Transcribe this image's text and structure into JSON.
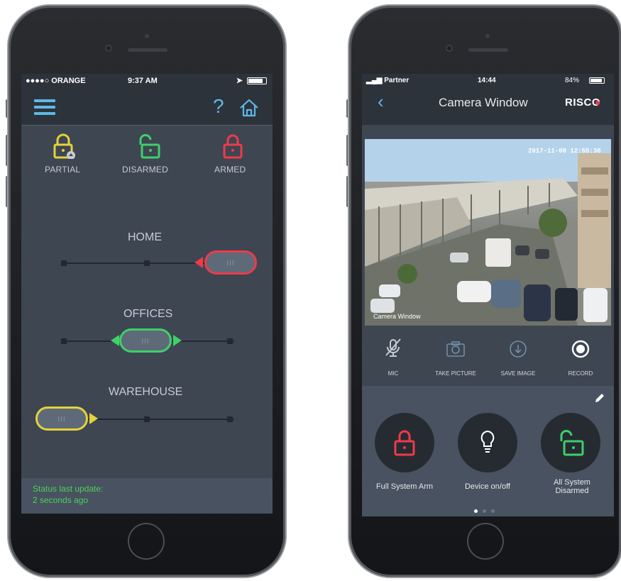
{
  "colors": {
    "partial": "#e4d23a",
    "disarmed": "#3ed06a",
    "armed": "#ef3a4a",
    "status_text": "#4fd05a"
  },
  "left_phone": {
    "status_bar": {
      "carrier": "●●●●○ ORANGE",
      "time": "9:37 AM"
    },
    "header": {
      "help_label": "?"
    },
    "modes": [
      {
        "label": "PARTIAL",
        "icon": "partial-lock-icon"
      },
      {
        "label": "DISARMED",
        "icon": "open-lock-icon"
      },
      {
        "label": "ARMED",
        "icon": "closed-lock-icon"
      }
    ],
    "partitions": [
      {
        "name": "HOME",
        "state": "ARMED",
        "position": 2
      },
      {
        "name": "OFFICES",
        "state": "DISARMED",
        "position": 1
      },
      {
        "name": "WAREHOUSE",
        "state": "PARTIAL",
        "position": 0
      }
    ],
    "status": {
      "line1": "Status last update:",
      "line2": "2 seconds ago"
    }
  },
  "right_phone": {
    "status_bar": {
      "carrier": "Partner",
      "time": "14:44",
      "battery": "84%"
    },
    "header": {
      "title": "Camera Window",
      "brand": "RISCO",
      "back_label": "‹"
    },
    "camera": {
      "timestamp": "2017-11-08 12:55:30",
      "caption": "Camera Window"
    },
    "actions": [
      {
        "label": "MIC",
        "icon": "mic-muted-icon"
      },
      {
        "label": "TAKE PICTURE",
        "icon": "camera-icon"
      },
      {
        "label": "SAVE IMAGE",
        "icon": "download-icon"
      },
      {
        "label": "RECORD",
        "icon": "record-icon"
      }
    ],
    "shortcuts": [
      {
        "label": "Full System Arm",
        "icon": "closed-lock-icon"
      },
      {
        "label": "Device on/off",
        "icon": "lightbulb-icon"
      },
      {
        "label": "All System Disarmed",
        "icon": "open-lock-icon"
      }
    ],
    "pager": {
      "pages": 3,
      "current": 1
    }
  }
}
